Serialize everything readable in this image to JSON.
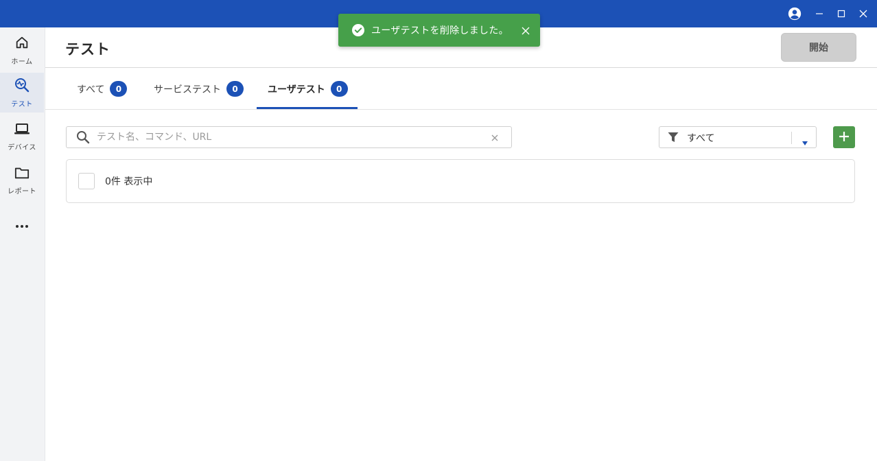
{
  "window": {
    "accent_color": "#1c51b6",
    "icons": [
      "account-circle-icon",
      "minimize-icon",
      "maximize-icon",
      "close-icon"
    ]
  },
  "sidebar": {
    "items": [
      {
        "label": "ホーム",
        "icon": "home-icon"
      },
      {
        "label": "テスト",
        "icon": "test-search-icon",
        "active": true
      },
      {
        "label": "デバイス",
        "icon": "laptop-icon"
      },
      {
        "label": "レポート",
        "icon": "folder-icon"
      },
      {
        "label": "",
        "icon": "more-icon"
      }
    ]
  },
  "header": {
    "title": "テスト",
    "start_label": "開始"
  },
  "tabs": [
    {
      "label": "すべて",
      "count": "0"
    },
    {
      "label": "サービステスト",
      "count": "0"
    },
    {
      "label": "ユーザテスト",
      "count": "0",
      "active": true
    }
  ],
  "search": {
    "placeholder": "テスト名、コマンド、URL",
    "value": ""
  },
  "filter": {
    "value": "すべて"
  },
  "list": {
    "count_text": "0件 表示中"
  },
  "toast": {
    "message": "ユーザテストを削除しました。",
    "color": "#46a04a"
  }
}
